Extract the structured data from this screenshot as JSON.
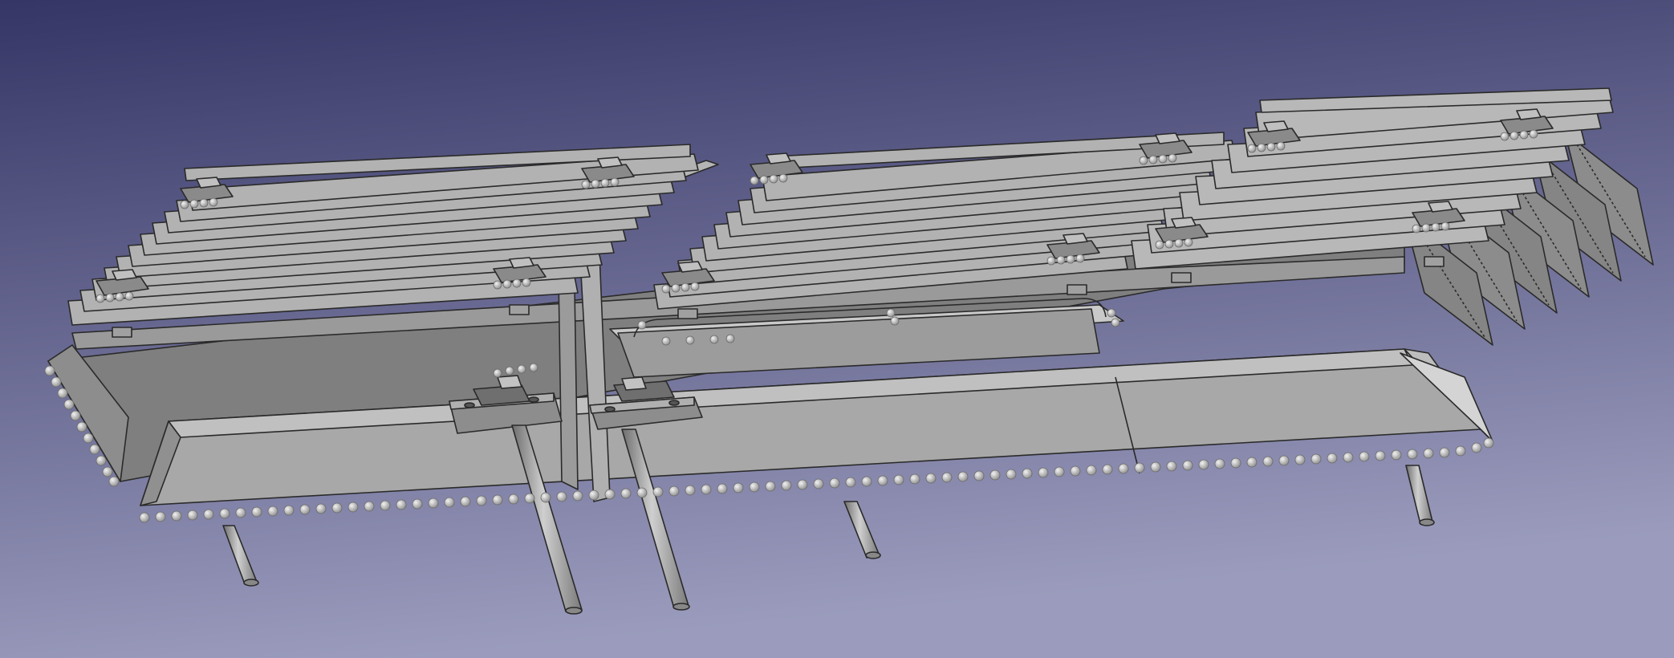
{
  "viewport": {
    "background_top": "#353566",
    "background_bottom": "#9b9cbd",
    "model_fill": "#a9a9a9",
    "model_light": "#c4c4c4",
    "model_dark": "#777777",
    "model_edge": "#2a2a2a",
    "weld_fill": "#d8d8d8"
  }
}
